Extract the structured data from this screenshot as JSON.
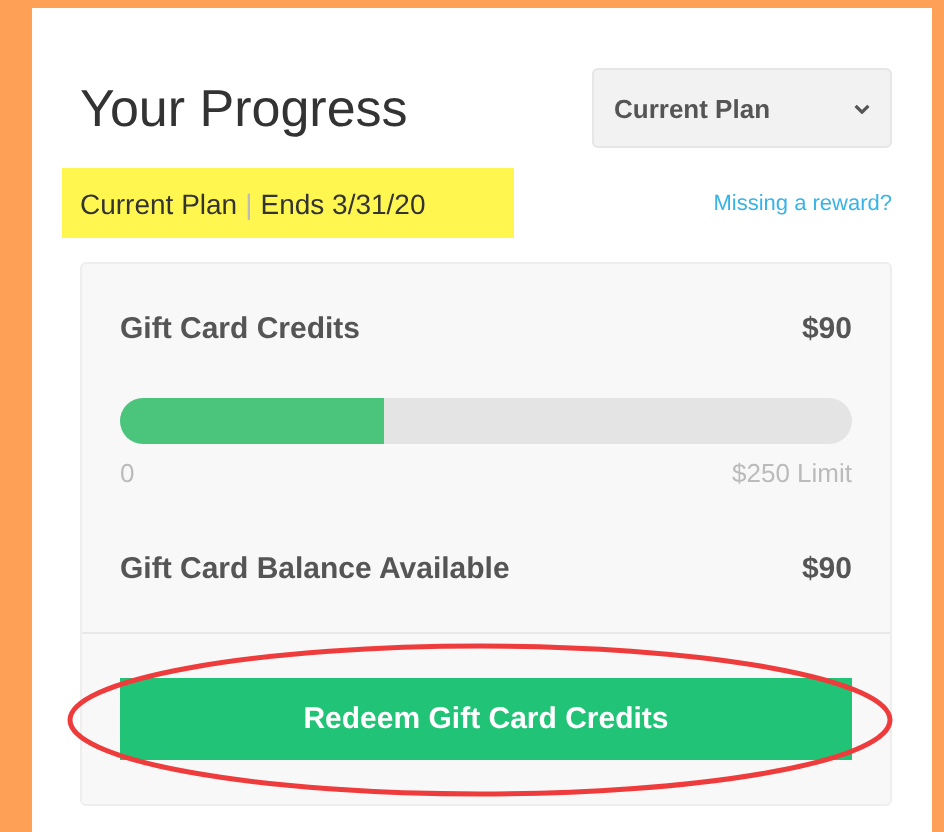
{
  "title": "Your Progress",
  "plan_select": {
    "value": "Current Plan"
  },
  "plan_badge": {
    "plan": "Current Plan",
    "separator": "|",
    "ends": "Ends 3/31/20"
  },
  "missing_link": "Missing a reward?",
  "credits": {
    "label": "Gift Card Credits",
    "amount": "$90",
    "level": 0.36,
    "min_label": "0",
    "limit_label": "$250 Limit"
  },
  "balance": {
    "label": "Gift Card Balance Available",
    "amount": "$90"
  },
  "redeem_button": {
    "label": "Redeem Gift Card Credits",
    "circled": true
  }
}
